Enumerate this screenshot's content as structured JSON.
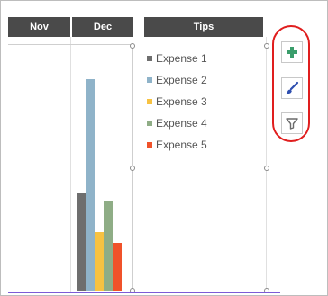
{
  "header": {
    "nov_label": "Nov",
    "dec_label": "Dec",
    "tips_label": "Tips"
  },
  "chart_data": {
    "type": "bar",
    "categories": [
      "Dec"
    ],
    "series": [
      {
        "name": "Expense 1",
        "color": "#6e6e6e",
        "values": [
          108
        ]
      },
      {
        "name": "Expense 2",
        "color": "#8fb3c9",
        "values": [
          235
        ]
      },
      {
        "name": "Expense 3",
        "color": "#f7c242",
        "values": [
          65
        ]
      },
      {
        "name": "Expense 4",
        "color": "#8fad86",
        "values": [
          100
        ]
      },
      {
        "name": "Expense 5",
        "color": "#f0522a",
        "values": [
          53
        ]
      }
    ],
    "ylim": [
      0,
      272
    ],
    "legend": "right"
  },
  "chart_tools": {
    "add_element_icon": "plus-icon",
    "styles_icon": "brush-icon",
    "filter_icon": "filter-icon",
    "highlight_color": "#e01e1e",
    "plus_color": "#3a9d6b",
    "brush_color": "#2f4fb0",
    "filter_color": "#6a6a6a"
  }
}
